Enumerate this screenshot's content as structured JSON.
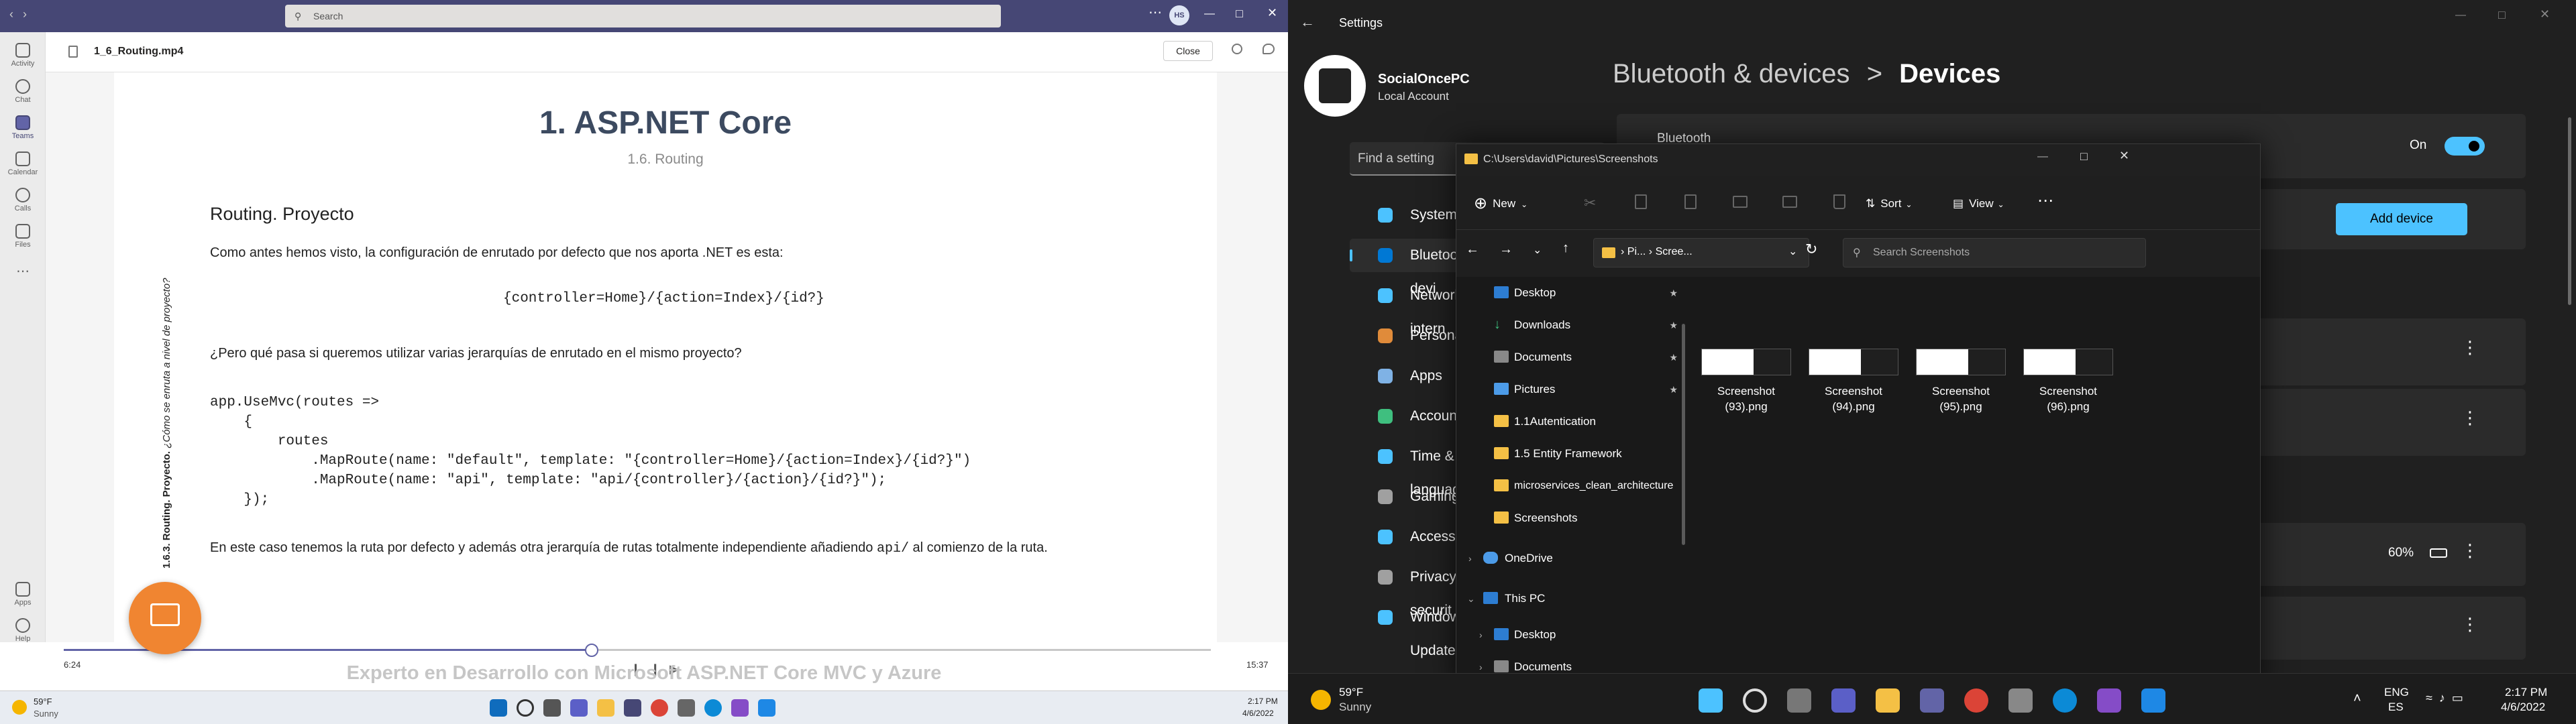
{
  "teams": {
    "search_placeholder": "Search",
    "avatar_initials": "HS",
    "file_name": "1_6_Routing.mp4",
    "close_label": "Close",
    "rail": [
      "Activity",
      "Chat",
      "Teams",
      "Calendar",
      "Calls",
      "Files"
    ],
    "rail_bottom": [
      "Apps",
      "Help"
    ],
    "doc": {
      "title": "1. ASP.NET Core",
      "subtitle": "1.6. Routing",
      "heading": "Routing. Proyecto",
      "p1": "Como antes hemos visto, la configuración de enrutado por defecto que nos aporta .NET es esta:",
      "code1": "{controller=Home}/{action=Index}/{id?}",
      "p2": "¿Pero qué pasa si queremos utilizar varias jerarquías de enrutado en el mismo proyecto?",
      "code_lines": [
        "app.UseMvc(routes =>",
        "    {",
        "        routes",
        "            .MapRoute(name: \"default\", template: \"{controller=Home}/{action=Index}/{id?}\")",
        "            .MapRoute(name: \"api\", template: \"api/{controller}/{action}/{id?}\");",
        "    });"
      ],
      "p3_pre": "En este caso tenemos la ruta por defecto y además otra jerarquía de rutas totalmente independiente añadiendo ",
      "p3_code": "api/",
      "p3_post": " al comienzo de la ruta.",
      "side_bold": "1.6.3. Routing. Proyecto.",
      "side_italic": " ¿Cómo se enruta a nivel de proyecto?",
      "footer": "Experto en Desarrollo con Microsoft ASP.NET Core MVC y Azure"
    },
    "video": {
      "current": "6:24",
      "total": "15:37",
      "progress": 0.46
    },
    "weather_temp": "59°F",
    "weather_cond": "Sunny",
    "clock_time": "2:17 PM",
    "clock_date": "4/6/2022"
  },
  "settings": {
    "window_title": "Settings",
    "account_name": "SocialOncePC",
    "account_type": "Local Account",
    "search_placeholder": "Find a setting",
    "breadcrumb_parent": "Bluetooth & devices",
    "breadcrumb_sep": ">",
    "breadcrumb_current": "Devices",
    "bluetooth_label": "Bluetooth",
    "bluetooth_state": "On",
    "add_device": "Add device",
    "battery_pct": "60%",
    "nav": [
      {
        "label": "System",
        "color": "#4cc2ff"
      },
      {
        "label": "Bluetooth & devi",
        "color": "#0078d4"
      },
      {
        "label": "Network & intern",
        "color": "#4cc2ff"
      },
      {
        "label": "Personalization",
        "color": "#e08b3a"
      },
      {
        "label": "Apps",
        "color": "#7fb2e5"
      },
      {
        "label": "Accounts",
        "color": "#3fbf7f"
      },
      {
        "label": "Time & language",
        "color": "#4cc2ff"
      },
      {
        "label": "Gaming",
        "color": "#a0a0a0"
      },
      {
        "label": "Accessibility",
        "color": "#4cc2ff"
      },
      {
        "label": "Privacy & securit",
        "color": "#a0a0a0"
      },
      {
        "label": "Windows Update",
        "color": "#4cc2ff"
      }
    ],
    "weather_temp": "59°F",
    "weather_cond": "Sunny",
    "lang1": "ENG",
    "lang2": "ES",
    "clock_time": "2:17 PM",
    "clock_date": "4/6/2022"
  },
  "explorer": {
    "title": "C:\\Users\\david\\Pictures\\Screenshots",
    "new_label": "New",
    "sort_label": "Sort",
    "view_label": "View",
    "crumb1": "Pi...",
    "crumb2": "Scree...",
    "search_placeholder": "Search Screenshots",
    "tree": [
      {
        "label": "Desktop",
        "pinned": true,
        "icon": "desktop"
      },
      {
        "label": "Downloads",
        "pinned": true,
        "icon": "download"
      },
      {
        "label": "Documents",
        "pinned": true,
        "icon": "documents"
      },
      {
        "label": "Pictures",
        "pinned": true,
        "icon": "pictures"
      },
      {
        "label": "1.1Autentication",
        "pinned": false,
        "icon": "folder"
      },
      {
        "label": "1.5 Entity Framework",
        "pinned": false,
        "icon": "folder"
      },
      {
        "label": "microservices_clean_architecture",
        "pinned": false,
        "icon": "folder"
      },
      {
        "label": "Screenshots",
        "pinned": false,
        "icon": "folder"
      }
    ],
    "onedrive": "OneDrive",
    "thispc": "This PC",
    "pc_items": [
      "Desktop",
      "Documents"
    ],
    "files": [
      {
        "line1": "Screenshot",
        "line2": "(93).png"
      },
      {
        "line1": "Screenshot",
        "line2": "(94).png"
      },
      {
        "line1": "Screenshot",
        "line2": "(95).png"
      },
      {
        "line1": "Screenshot",
        "line2": "(96).png"
      }
    ]
  }
}
